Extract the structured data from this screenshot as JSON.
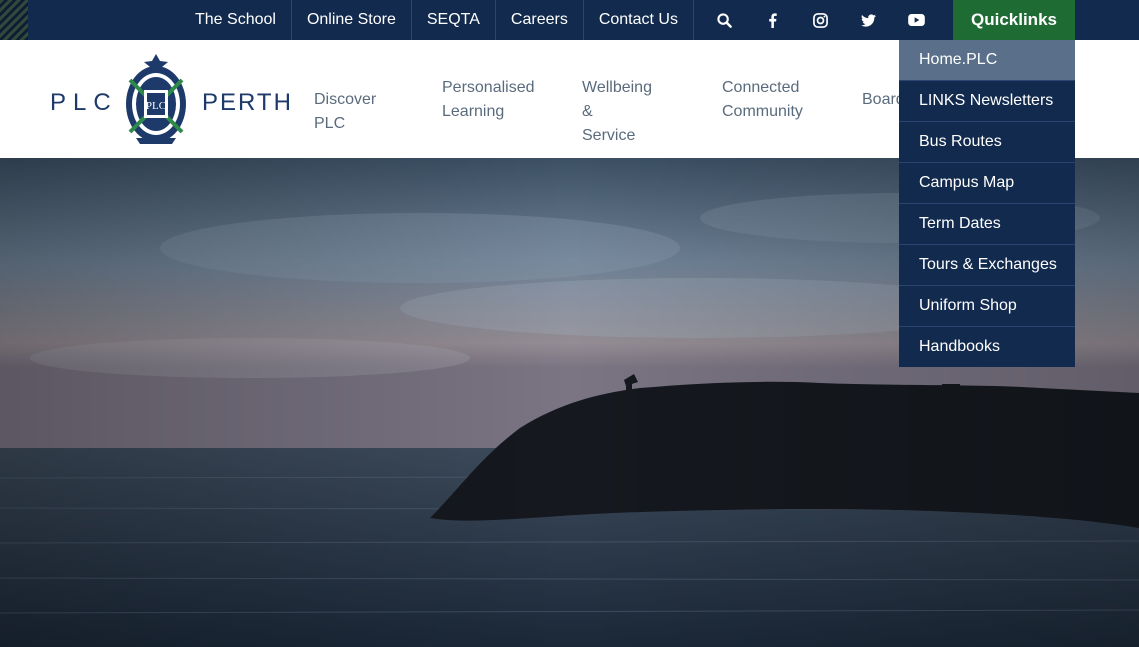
{
  "top_nav": {
    "links": [
      "The School",
      "Online Store",
      "SEQTA",
      "Careers",
      "Contact Us"
    ],
    "socials": [
      "search-icon",
      "facebook-icon",
      "instagram-icon",
      "twitter-icon",
      "youtube-icon"
    ],
    "quicklinks_label": "Quicklinks"
  },
  "logo": {
    "left_text": "PLC",
    "right_text": "PERTH",
    "crest_text": "PLC"
  },
  "main_nav": {
    "items": [
      {
        "line1": "Discover PLC",
        "line2": ""
      },
      {
        "line1": "Personalised",
        "line2": "Learning"
      },
      {
        "line1": "Wellbeing &",
        "line2": "Service"
      },
      {
        "line1": "Connected",
        "line2": "Community"
      },
      {
        "line1": "Board",
        "line2": ""
      }
    ]
  },
  "quicklinks": {
    "items": [
      "Home.PLC",
      "LINKS Newsletters",
      "Bus Routes",
      "Campus Map",
      "Term Dates",
      "Tours & Exchanges",
      "Uniform Shop",
      "Handbooks"
    ],
    "active_index": 0
  },
  "colors": {
    "navy": "#112a4e",
    "green": "#1f6b34",
    "logo_blue": "#1d3a6b"
  }
}
